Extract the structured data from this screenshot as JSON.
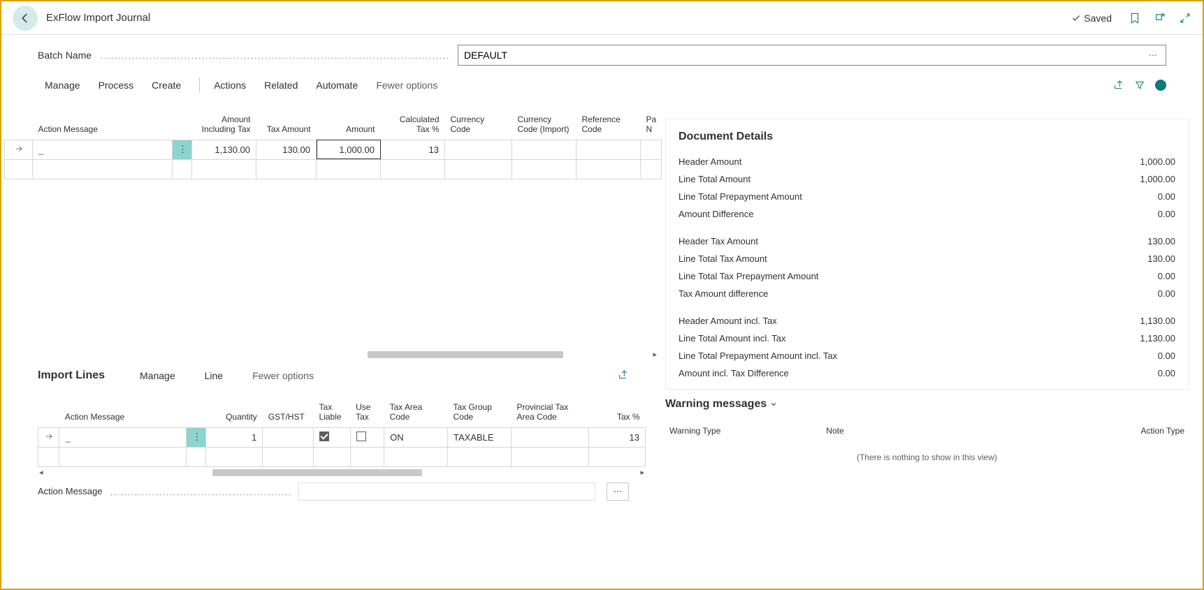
{
  "header": {
    "title": "ExFlow Import Journal",
    "saved_label": "Saved"
  },
  "batch": {
    "label": "Batch Name",
    "value": "DEFAULT"
  },
  "commands": {
    "manage": "Manage",
    "process": "Process",
    "create": "Create",
    "actions": "Actions",
    "related": "Related",
    "automate": "Automate",
    "fewer": "Fewer options"
  },
  "main_grid": {
    "columns": {
      "action_message": "Action Message",
      "amount_incl_tax": "Amount Including Tax",
      "tax_amount": "Tax Amount",
      "amount": "Amount",
      "calc_tax_pct": "Calculated Tax %",
      "currency_code": "Currency Code",
      "currency_code_import": "Currency Code (Import)",
      "reference_code": "Reference Code",
      "pa": "Pa N"
    },
    "rows": [
      {
        "action_message": "_",
        "amount_incl_tax": "1,130.00",
        "tax_amount": "130.00",
        "amount": "1,000.00",
        "calc_tax_pct": "13",
        "currency_code": "",
        "currency_code_import": "",
        "reference_code": ""
      }
    ]
  },
  "import_lines": {
    "title": "Import Lines",
    "commands": {
      "manage": "Manage",
      "line": "Line",
      "fewer": "Fewer options"
    },
    "columns": {
      "action_message": "Action Message",
      "quantity": "Quantity",
      "gst_hst": "GST/HST",
      "tax_liable": "Tax Liable",
      "use_tax": "Use Tax",
      "tax_area_code": "Tax Area Code",
      "tax_group_code": "Tax Group Code",
      "prov_tax_area": "Provincial Tax Area Code",
      "tax_pct": "Tax %"
    },
    "rows": [
      {
        "action_message": "_",
        "quantity": "1",
        "gst_hst": "",
        "tax_liable": true,
        "use_tax": false,
        "tax_area_code": "ON",
        "tax_group_code": "TAXABLE",
        "prov_tax_area": "",
        "tax_pct": "13"
      }
    ]
  },
  "footer": {
    "action_message_label": "Action Message"
  },
  "details": {
    "title": "Document Details",
    "items": [
      {
        "k": "Header Amount",
        "v": "1,000.00"
      },
      {
        "k": "Line Total Amount",
        "v": "1,000.00"
      },
      {
        "k": "Line Total Prepayment Amount",
        "v": "0.00"
      },
      {
        "k": "Amount Difference",
        "v": "0.00"
      }
    ],
    "items2": [
      {
        "k": "Header Tax Amount",
        "v": "130.00"
      },
      {
        "k": "Line Total Tax Amount",
        "v": "130.00"
      },
      {
        "k": "Line Total Tax Prepayment Amount",
        "v": "0.00"
      },
      {
        "k": "Tax Amount difference",
        "v": "0.00"
      }
    ],
    "items3": [
      {
        "k": "Header Amount incl. Tax",
        "v": "1,130.00"
      },
      {
        "k": "Line Total Amount incl. Tax",
        "v": "1,130.00"
      },
      {
        "k": "Line Total Prepayment Amount incl. Tax",
        "v": "0.00"
      },
      {
        "k": "Amount incl. Tax Difference",
        "v": "0.00"
      }
    ]
  },
  "warnings": {
    "title": "Warning messages",
    "columns": {
      "type": "Warning Type",
      "note": "Note",
      "action_type": "Action Type"
    },
    "empty": "(There is nothing to show in this view)"
  }
}
